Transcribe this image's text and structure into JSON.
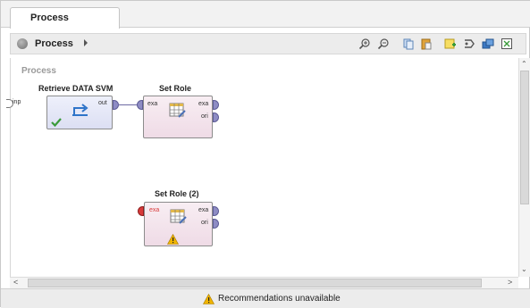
{
  "tab": {
    "label": "Process"
  },
  "breadcrumb": {
    "label": "Process"
  },
  "toolbar_icons": [
    "zoom-in-icon",
    "zoom-out-icon",
    "copy-icon",
    "paste-icon",
    "add-note-icon",
    "connect-icon",
    "arrange-icon",
    "fit-icon"
  ],
  "canvas": {
    "title": "Process",
    "left_port_label": "inp"
  },
  "operators": [
    {
      "title": "Retrieve DATA SVM",
      "ports_out": [
        "out"
      ],
      "status": "ok"
    },
    {
      "title": "Set Role",
      "ports_in": [
        "exa"
      ],
      "ports_out": [
        "exa",
        "ori"
      ],
      "status": "ok"
    },
    {
      "title": "Set Role (2)",
      "ports_in": [
        "exa"
      ],
      "ports_out": [
        "exa",
        "ori"
      ],
      "status": "warning"
    }
  ],
  "statusbar": {
    "text": "Recommendations unavailable"
  },
  "colors": {
    "port": "#8e8cc4",
    "error_port": "#d83a3a",
    "warning": "#f0b400",
    "ok": "#3a9a3a"
  }
}
